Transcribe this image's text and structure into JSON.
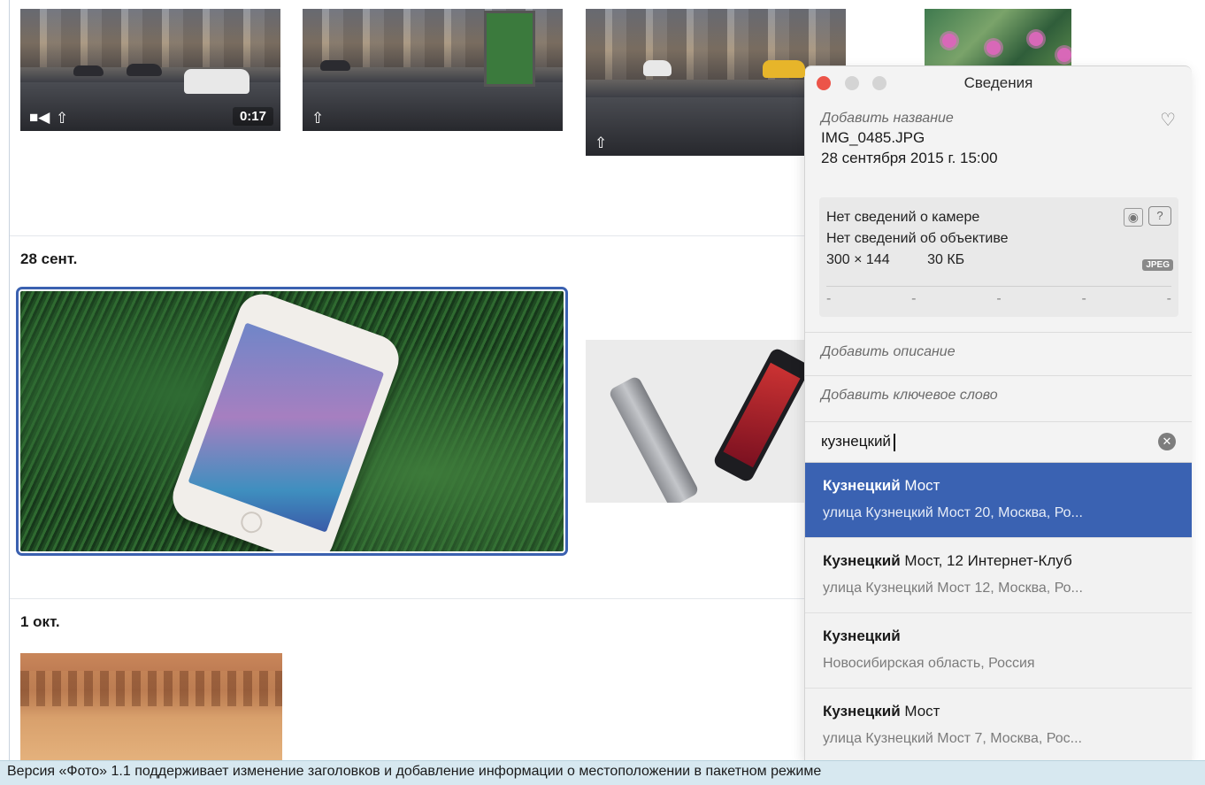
{
  "grid": {
    "video_duration": "0:17",
    "sections": [
      {
        "date": "28 сент."
      },
      {
        "date": "1 окт."
      }
    ]
  },
  "info_panel": {
    "title": "Сведения",
    "add_title_placeholder": "Добавить название",
    "filename": "IMG_0485.JPG",
    "datetime": "28 сентября 2015 г.  15:00",
    "camera_info": "Нет сведений о камере",
    "lens_info": "Нет сведений об объективе",
    "dimensions": "300 × 144",
    "file_size": "30 КБ",
    "format_badge": "JPEG",
    "exif_dashes": [
      "-",
      "-",
      "-",
      "-",
      "-"
    ],
    "add_description_placeholder": "Добавить описание",
    "add_keyword_placeholder": "Добавить ключевое слово",
    "location_input_value": "кузнецкий",
    "suggestions": [
      {
        "match": "Кузнецкий",
        "rest": " Мост",
        "subtitle": "улица Кузнецкий Мост 20, Москва, Ро..."
      },
      {
        "match": "Кузнецкий",
        "rest": " Мост, 12 Интернет-Клуб",
        "subtitle": "улица Кузнецкий Мост 12, Москва, Ро..."
      },
      {
        "match": "Кузнецкий",
        "rest": "",
        "subtitle": "Новосибирская область, Россия"
      },
      {
        "match": "Кузнецкий",
        "rest": " Мост",
        "subtitle": "улица Кузнецкий Мост 7, Москва, Рос..."
      }
    ]
  },
  "caption": "Версия «Фото» 1.1 поддерживает изменение заголовков и добавление информации о местоположении в пакетном режиме",
  "colors": {
    "selection": "#3b61b0",
    "close_button": "#ec5449",
    "caption_bg": "#d7e8f0"
  }
}
